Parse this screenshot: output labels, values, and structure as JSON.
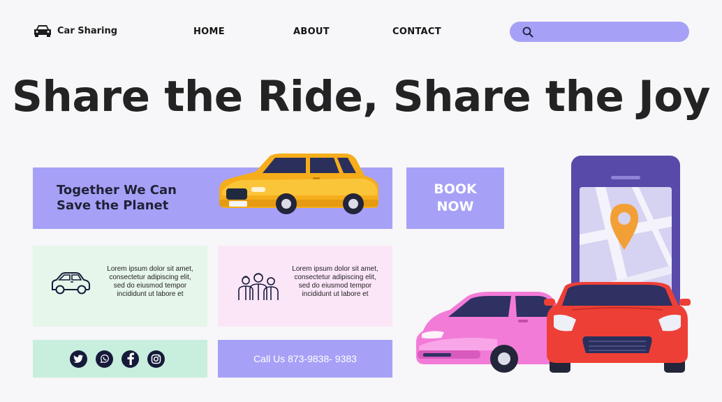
{
  "brand": {
    "name": "Car Sharing",
    "icon": "car-icon"
  },
  "nav": {
    "items": [
      {
        "label": "HOME"
      },
      {
        "label": "ABOUT"
      },
      {
        "label": "CONTACT"
      }
    ]
  },
  "search": {
    "icon": "search-icon",
    "placeholder": "",
    "value": ""
  },
  "hero": {
    "headline": "Share the Ride, Share the Joy"
  },
  "promo": {
    "line1": "Together We Can",
    "line2": "Save the Planet",
    "image": "yellow-car-illustration"
  },
  "book_button": {
    "line1": "BOOK",
    "line2": "NOW"
  },
  "features": [
    {
      "icon": "car-outline-icon",
      "text": "Lorem ipsum dolor sit amet, consectetur adipiscing elit, sed do eiusmod tempor incididunt ut labore et"
    },
    {
      "icon": "people-group-icon",
      "text": "Lorem ipsum dolor sit amet, consectetur adipiscing elit, sed do eiusmod tempor incididunt ut labore et"
    }
  ],
  "social": [
    {
      "icon": "twitter-icon"
    },
    {
      "icon": "whatsapp-icon"
    },
    {
      "icon": "facebook-icon"
    },
    {
      "icon": "instagram-icon"
    }
  ],
  "call": {
    "label": "Call Us 873-9838- 9383"
  },
  "colors": {
    "accent": "#a6a1f7",
    "background": "#f7f6f8",
    "mint": "#e6f6ea",
    "pink": "#fbe6f8",
    "social_bg": "#c8eedd",
    "phone": "#574aa9",
    "text_dark": "#232323"
  }
}
